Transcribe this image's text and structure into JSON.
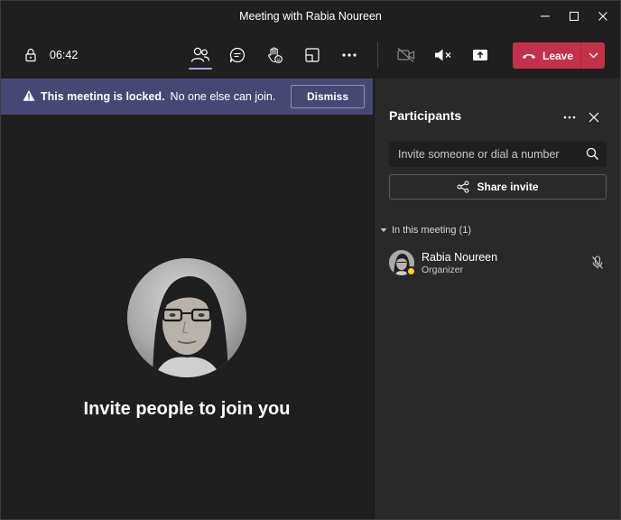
{
  "window": {
    "title": "Meeting with Rabia Noureen"
  },
  "toolbar": {
    "timer": "06:42",
    "leave_label": "Leave"
  },
  "banner": {
    "bold": "This meeting is locked.",
    "text": "No one else can join.",
    "dismiss_label": "Dismiss"
  },
  "stage": {
    "invite_text": "Invite people to join you"
  },
  "panel": {
    "title": "Participants",
    "search_placeholder": "Invite someone or dial a number",
    "share_label": "Share invite",
    "section_label": "In this meeting (1)",
    "participants": [
      {
        "name": "Rabia Noureen",
        "role": "Organizer"
      }
    ]
  },
  "colors": {
    "background": "#1f1f1f",
    "panel": "#292929",
    "banner": "#464775",
    "leave": "#c4314b",
    "active_underline": "#a6a7dc",
    "status_away": "#f8d22a"
  }
}
